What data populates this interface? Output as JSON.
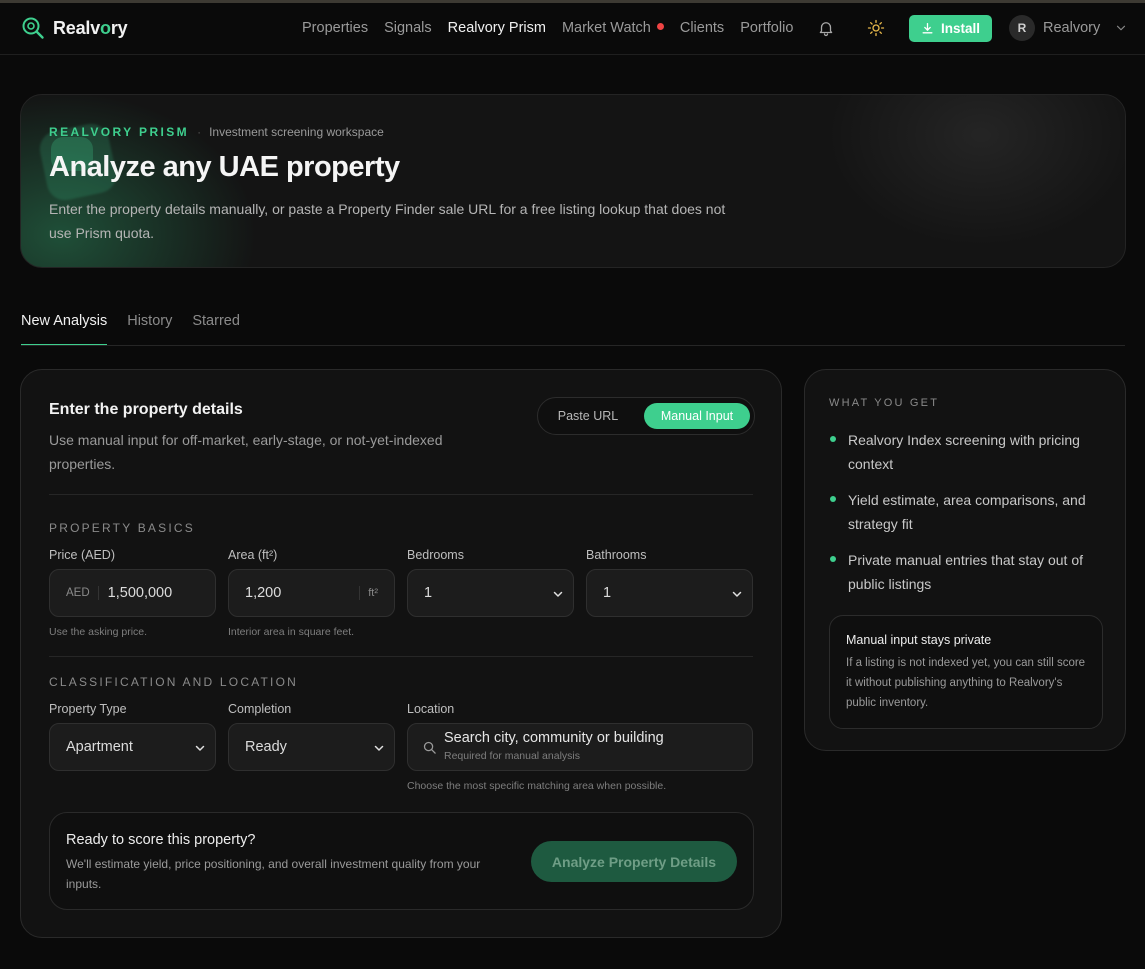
{
  "brand": {
    "name_prefix": "Realv",
    "name_accent": "o",
    "name_suffix": "ry"
  },
  "nav": {
    "links": [
      "Properties",
      "Signals",
      "Realvory Prism",
      "Market Watch",
      "Clients",
      "Portfolio"
    ],
    "active": "Realvory Prism",
    "install_label": "Install",
    "user_initial": "R",
    "user_name": "Realvory"
  },
  "hero": {
    "eyebrow_brand": "REALVORY PRISM",
    "eyebrow_separator": "·",
    "eyebrow_subtitle": "Investment screening workspace",
    "title": "Analyze any UAE property",
    "description": "Enter the property details manually, or paste a Property Finder sale URL for a free listing lookup that does not use Prism quota."
  },
  "tabs": [
    "New Analysis",
    "History",
    "Starred"
  ],
  "form": {
    "title": "Enter the property details",
    "description": "Use manual input for off-market, early-stage, or not-yet-indexed properties.",
    "mode_toggle": {
      "paste_url": "Paste URL",
      "manual_input": "Manual Input",
      "selected": "Manual Input"
    },
    "basics_label": "PROPERTY BASICS",
    "price": {
      "label": "Price (AED)",
      "prefix": "AED",
      "value": "1,500,000",
      "help": "Use the asking price."
    },
    "area": {
      "label": "Area (ft²)",
      "value": "1,200",
      "suffix": "ft²",
      "help": "Interior area in square feet."
    },
    "bedrooms": {
      "label": "Bedrooms",
      "value": "1"
    },
    "bathrooms": {
      "label": "Bathrooms",
      "value": "1"
    },
    "classification_label": "CLASSIFICATION AND LOCATION",
    "property_type": {
      "label": "Property Type",
      "value": "Apartment"
    },
    "completion": {
      "label": "Completion",
      "value": "Ready"
    },
    "location": {
      "label": "Location",
      "placeholder": "Search city, community or building",
      "sub": "Required for manual analysis",
      "help": "Choose the most specific matching area when possible."
    },
    "ready": {
      "title": "Ready to score this property?",
      "description": "We'll estimate yield, price positioning, and overall investment quality from your inputs.",
      "button": "Analyze Property Details"
    }
  },
  "side": {
    "label": "WHAT YOU GET",
    "benefits": [
      "Realvory Index screening with pricing context",
      "Yield estimate, area comparisons, and strategy fit",
      "Private manual entries that stay out of public listings"
    ],
    "private_title": "Manual input stays private",
    "private_desc": "If a listing is not indexed yet, you can still score it without publishing anything to Realvory's public inventory."
  },
  "colors": {
    "accent": "#3ecf8e",
    "background": "#0a0a0a",
    "card": "#121212",
    "alert_dot": "#ef4444"
  }
}
